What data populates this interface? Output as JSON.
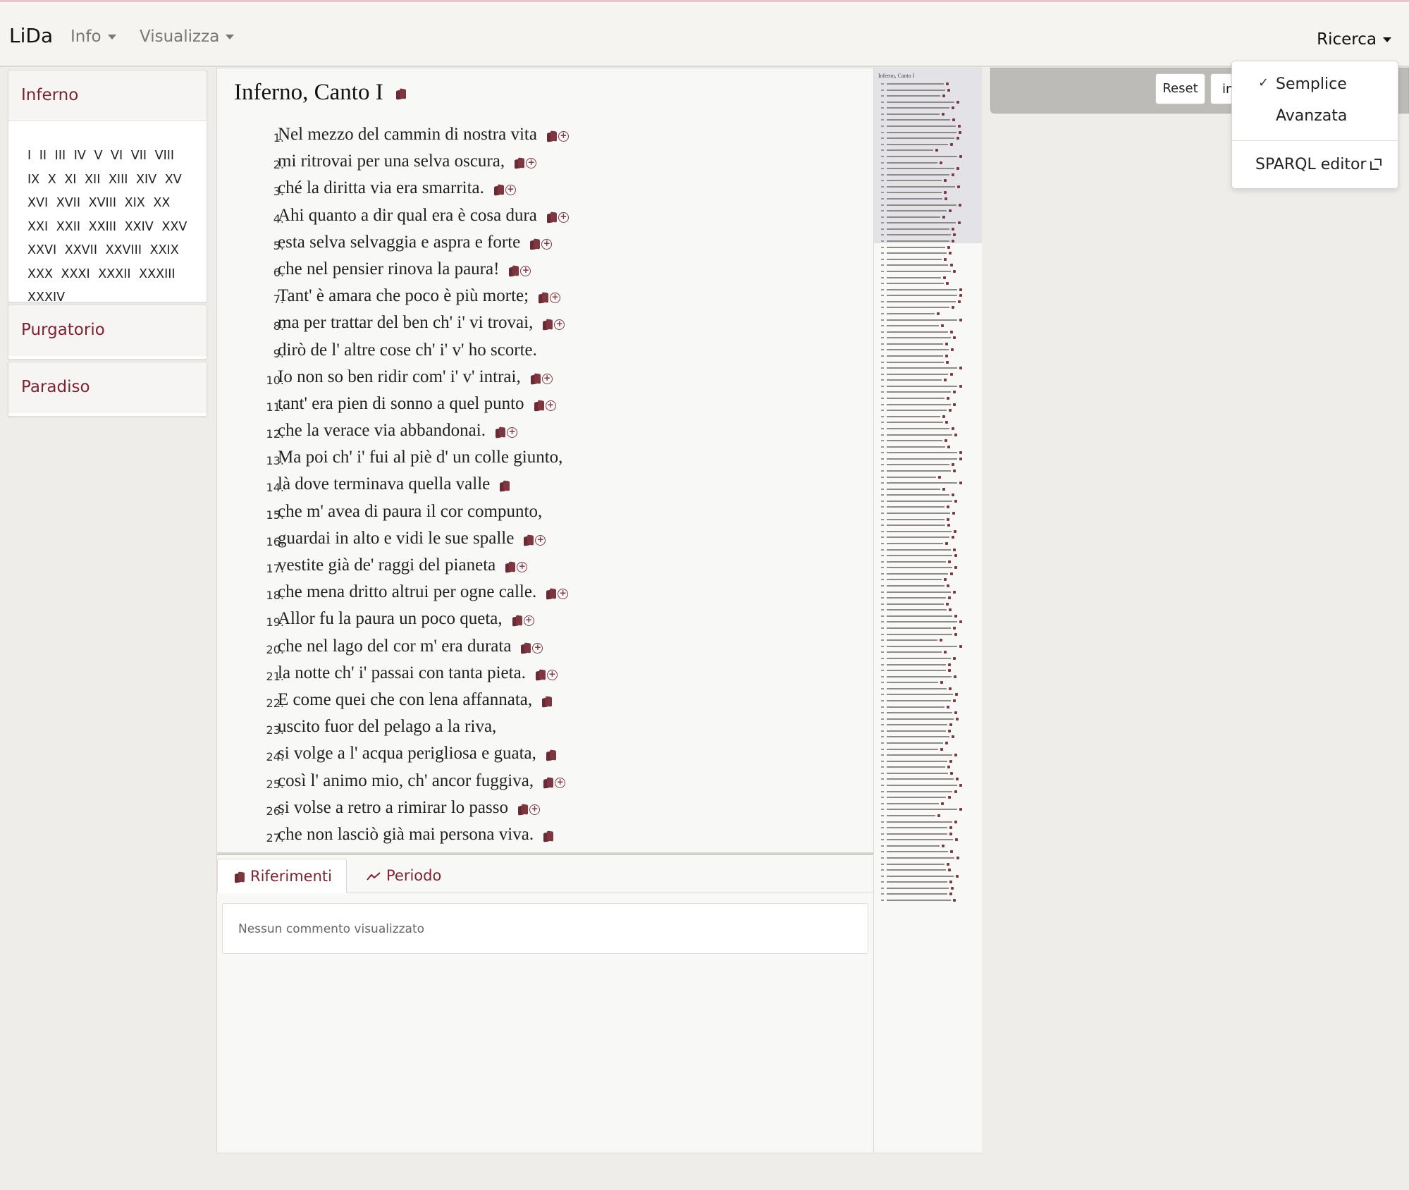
{
  "navbar": {
    "brand": "LiDa",
    "info_label": "Info",
    "visualizza_label": "Visualizza",
    "ricerca_label": "Ricerca"
  },
  "sidebar": {
    "inferno_label": "Inferno",
    "purgatorio_label": "Purgatorio",
    "paradiso_label": "Paradiso",
    "canti": [
      "I",
      "II",
      "III",
      "IV",
      "V",
      "VI",
      "VII",
      "VIII",
      "IX",
      "X",
      "XI",
      "XII",
      "XIII",
      "XIV",
      "XV",
      "XVI",
      "XVII",
      "XVIII",
      "XIX",
      "XX",
      "XXI",
      "XXII",
      "XXIII",
      "XXIV",
      "XXV",
      "XXVI",
      "XXVII",
      "XXVIII",
      "XXIX",
      "XXX",
      "XXXI",
      "XXXII",
      "XXXIII",
      "XXXIV"
    ]
  },
  "main": {
    "title": "Inferno, Canto I",
    "verses": [
      {
        "n": "1.",
        "text": "Nel mezzo del cammin di nostra vita",
        "plus": true
      },
      {
        "n": "2.",
        "text": "mi ritrovai per una selva oscura,",
        "plus": true
      },
      {
        "n": "3.",
        "text": "ché la diritta via era smarrita.",
        "plus": true
      },
      {
        "n": "4.",
        "text": "Ahi quanto a dir qual era è cosa dura",
        "plus": true
      },
      {
        "n": "5.",
        "text": "esta selva selvaggia e aspra e forte",
        "plus": true
      },
      {
        "n": "6.",
        "text": "che nel pensier rinova la paura!",
        "plus": true
      },
      {
        "n": "7.",
        "text": "Tant' è amara che poco è più morte;",
        "plus": true
      },
      {
        "n": "8.",
        "text": "ma per trattar del ben ch' i' vi trovai,",
        "plus": true
      },
      {
        "n": "9.",
        "text": "dirò de l' altre cose ch' i' v' ho scorte.",
        "plus": false,
        "book": false
      },
      {
        "n": "10.",
        "text": "Io non so ben ridir com' i' v' intrai,",
        "plus": true
      },
      {
        "n": "11.",
        "text": "tant' era pien di sonno a quel punto",
        "plus": true
      },
      {
        "n": "12.",
        "text": "che la verace via abbandonai.",
        "plus": true
      },
      {
        "n": "13.",
        "text": "Ma poi ch' i' fui al piè d' un colle giunto,",
        "plus": false,
        "book": false
      },
      {
        "n": "14.",
        "text": "là dove terminava quella valle",
        "plus": false
      },
      {
        "n": "15.",
        "text": "che m' avea di paura il cor compunto,",
        "plus": false,
        "book": false
      },
      {
        "n": "16.",
        "text": "guardai in alto e vidi le sue spalle",
        "plus": true
      },
      {
        "n": "17.",
        "text": "vestite già de' raggi del pianeta",
        "plus": true
      },
      {
        "n": "18.",
        "text": "che mena dritto altrui per ogne calle.",
        "plus": true
      },
      {
        "n": "19.",
        "text": "Allor fu la paura un poco queta,",
        "plus": true
      },
      {
        "n": "20.",
        "text": "che nel lago del cor m' era durata",
        "plus": true
      },
      {
        "n": "21.",
        "text": "la notte ch' i' passai con tanta pieta.",
        "plus": true
      },
      {
        "n": "22.",
        "text": "E come quei che con lena affannata,",
        "plus": false
      },
      {
        "n": "23.",
        "text": "uscito fuor del pelago a la riva,",
        "plus": false,
        "book": false
      },
      {
        "n": "24.",
        "text": "si volge a l' acqua perigliosa e guata,",
        "plus": false
      },
      {
        "n": "25.",
        "text": "così l' animo mio, ch' ancor fuggiva,",
        "plus": true
      },
      {
        "n": "26.",
        "text": "si volse a retro a rimirar lo passo",
        "plus": true
      },
      {
        "n": "27.",
        "text": "che non lasciò già mai persona viva.",
        "plus": false
      }
    ]
  },
  "tabs": {
    "riferimenti_label": "Riferimenti",
    "periodo_label": "Periodo"
  },
  "comments": {
    "empty_text": "Nessun commento visualizzato"
  },
  "minimap": {
    "title": "Inferno, Canto I"
  },
  "search": {
    "reset_label": "Reset",
    "input_value": "in"
  },
  "ricerca_menu": {
    "semplice_label": "Semplice",
    "avanzata_label": "Avanzata",
    "sparql_label": "SPARQL editor",
    "checkmark": "✓"
  },
  "colors": {
    "accent": "#7b2532",
    "icon": "#6a2a35"
  }
}
